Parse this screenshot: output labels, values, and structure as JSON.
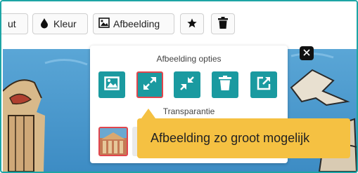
{
  "toolbar": {
    "cut_label": "ut",
    "color_label": "Kleur",
    "image_label": "Afbeelding"
  },
  "popup": {
    "title": "Afbeelding opties",
    "transparency_label": "Transparantie"
  },
  "tooltip": {
    "text": "Afbeelding zo groot mogelijk"
  },
  "colors": {
    "accent": "#1a9aa0",
    "frame": "#1da5a5",
    "selected": "#e1454d",
    "tooltip": "#f5c142"
  },
  "icons": [
    "droplet-icon",
    "image-icon",
    "star-icon",
    "trash-icon",
    "close-icon",
    "expand-icon",
    "shrink-icon",
    "external-link-icon"
  ]
}
